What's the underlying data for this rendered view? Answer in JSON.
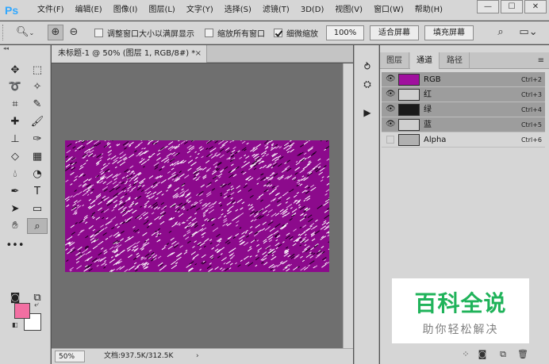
{
  "app": {
    "logo": "Ps"
  },
  "menu": [
    "文件(F)",
    "编辑(E)",
    "图像(I)",
    "图层(L)",
    "文字(Y)",
    "选择(S)",
    "滤镜(T)",
    "3D(D)",
    "视图(V)",
    "窗口(W)",
    "帮助(H)"
  ],
  "window_controls": {
    "minimize": "—",
    "restore": "☐",
    "close": "✕"
  },
  "options": {
    "tool_preset_icon": "zoom-icon",
    "zoom_in_icon": "zoom-in-icon",
    "zoom_out_icon": "zoom-out-icon",
    "resize_windows_label": "调整窗口大小以满屏显示",
    "resize_windows_checked": false,
    "zoom_all_label": "缩放所有窗口",
    "zoom_all_checked": false,
    "scrubby_label": "细微缩放",
    "scrubby_checked": true,
    "zoom_value": "100%",
    "fit_screen_label": "适合屏幕",
    "fill_screen_label": "填充屏幕"
  },
  "document": {
    "tab_title": "未标题-1 @ 50% (图层 1, RGB/8#) *",
    "close": "×",
    "canvas_color": "#8c0a8c",
    "zoom": "50%",
    "doc_info": "文档:937.5K/312.5K",
    "status_arrow": "›"
  },
  "swatches": {
    "foreground": "#f26fa2",
    "background": "#ffffff"
  },
  "panel": {
    "tabs": [
      "图层",
      "通道",
      "路径"
    ],
    "active_tab": "通道",
    "menu_icon": "≡",
    "channels": [
      {
        "name": "RGB",
        "shortcut": "Ctrl+2",
        "visible": true,
        "selected": true,
        "thumb": "#a0109e"
      },
      {
        "name": "红",
        "shortcut": "Ctrl+3",
        "visible": true,
        "selected": true,
        "thumb": "#d0d0d0"
      },
      {
        "name": "绿",
        "shortcut": "Ctrl+4",
        "visible": true,
        "selected": true,
        "thumb": "#1a1a1a"
      },
      {
        "name": "蓝",
        "shortcut": "Ctrl+5",
        "visible": true,
        "selected": true,
        "thumb": "#cfcfcf"
      },
      {
        "name": "Alpha",
        "shortcut": "Ctrl+6",
        "visible": false,
        "selected": false,
        "thumb": "#b0b0b0"
      }
    ]
  },
  "watermark": {
    "title": "百科全说",
    "subtitle": "助你轻松解决"
  }
}
